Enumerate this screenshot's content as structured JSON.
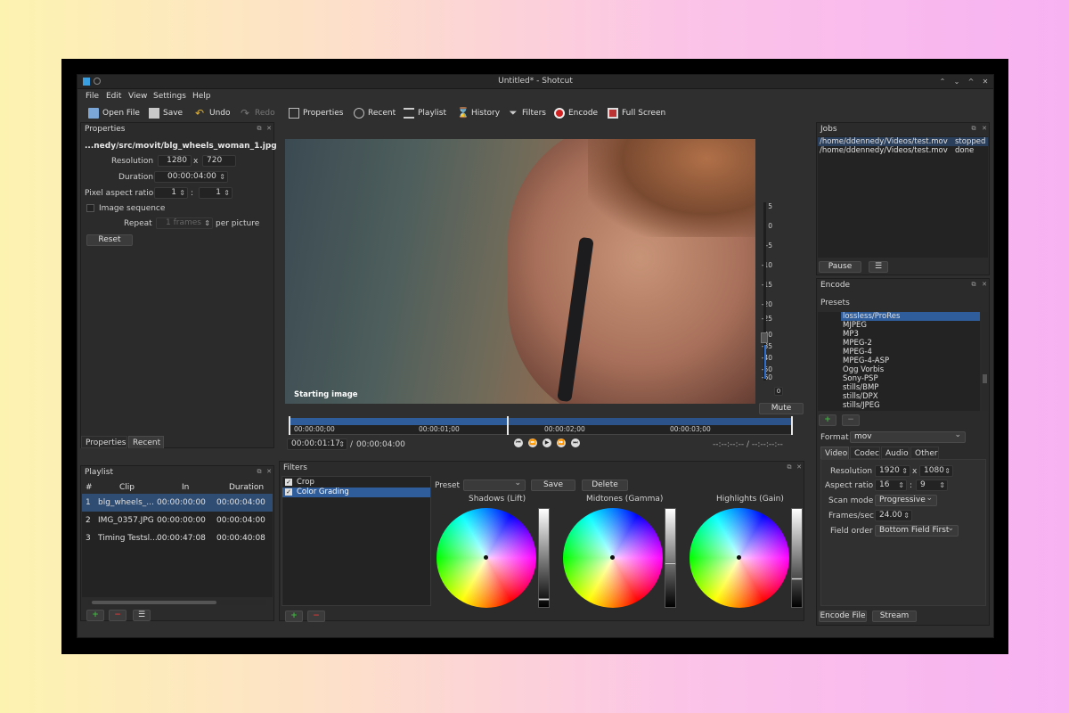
{
  "window": {
    "title": "Untitled* - Shotcut"
  },
  "menu": [
    "File",
    "Edit",
    "View",
    "Settings",
    "Help"
  ],
  "toolbar": {
    "open": "Open File",
    "save": "Save",
    "undo": "Undo",
    "redo": "Redo",
    "properties": "Properties",
    "recent": "Recent",
    "playlist": "Playlist",
    "history": "History",
    "filters": "Filters",
    "encode": "Encode",
    "fullscreen": "Full Screen"
  },
  "properties": {
    "title": "Properties",
    "filename": "...nedy/src/movit/blg_wheels_woman_1.jpg",
    "resolution_label": "Resolution",
    "res_w": "1280",
    "res_x": "x",
    "res_h": "720",
    "duration_label": "Duration",
    "duration": "00:00:04:00",
    "par_label": "Pixel aspect ratio",
    "par_a": "1",
    "par_colon": ":",
    "par_b": "1",
    "image_seq_label": "Image sequence",
    "repeat_label": "Repeat",
    "repeat_value": "1 frames",
    "per_picture": "per picture",
    "reset": "Reset",
    "tab_properties": "Properties",
    "tab_recent": "Recent"
  },
  "viewer": {
    "caption": "Starting image",
    "scale": [
      "5",
      "0",
      "-5",
      "-10",
      "-15",
      "-20",
      "-25",
      "-30",
      "-35",
      "-40",
      "-50",
      "-60"
    ],
    "mute": "Mute",
    "ruler": [
      "00:00:00;00",
      "00:00:01;00",
      "00:00:02;00",
      "00:00:03;00"
    ],
    "position": "00:00:01:17",
    "slash": "/",
    "total": "00:00:04:00",
    "inout": "--:--:--:-- / --:--:--:--"
  },
  "playlist": {
    "title": "Playlist",
    "columns": [
      "#",
      "Clip",
      "In",
      "Duration"
    ],
    "rows": [
      {
        "n": "1",
        "clip": "blg_wheels_...",
        "in": "00:00:00:00",
        "dur": "00:00:04:00"
      },
      {
        "n": "2",
        "clip": "IMG_0357.JPG",
        "in": "00:00:00:00",
        "dur": "00:00:04:00"
      },
      {
        "n": "3",
        "clip": "Timing Testsl...",
        "in": "00:00:47:08",
        "dur": "00:00:40:08"
      }
    ]
  },
  "filters": {
    "title": "Filters",
    "items": [
      "Crop",
      "Color Grading"
    ],
    "preset_label": "Preset",
    "save": "Save",
    "delete": "Delete",
    "wheels": [
      "Shadows (Lift)",
      "Midtones (Gamma)",
      "Highlights (Gain)"
    ],
    "levels": [
      0.05,
      0.43,
      0.27
    ]
  },
  "jobs": {
    "title": "Jobs",
    "items": [
      {
        "path": "/home/ddennedy/Videos/test.mov",
        "status": "stopped"
      },
      {
        "path": "/home/ddennedy/Videos/test.mov",
        "status": "done"
      }
    ],
    "pause": "Pause"
  },
  "encode": {
    "title": "Encode",
    "presets_label": "Presets",
    "presets": [
      "lossless/ProRes",
      "MJPEG",
      "MP3",
      "MPEG-2",
      "MPEG-4",
      "MPEG-4-ASP",
      "Ogg Vorbis",
      "Sony-PSP",
      "stills/BMP",
      "stills/DPX",
      "stills/JPEG"
    ],
    "format_label": "Format",
    "format": "mov",
    "tabs": [
      "Video",
      "Codec",
      "Audio",
      "Other"
    ],
    "resolution_label": "Resolution",
    "res_w": "1920",
    "res_x": "x",
    "res_h": "1080",
    "aspect_label": "Aspect ratio",
    "asp_a": "16",
    "asp_colon": ":",
    "asp_b": "9",
    "scan_label": "Scan mode",
    "scan": "Progressive",
    "fps_label": "Frames/sec",
    "fps": "24.00",
    "field_label": "Field order",
    "field": "Bottom Field First",
    "encode_file": "Encode File",
    "stream": "Stream"
  },
  "colors": {
    "accent": "#2f5d9c",
    "selection": "#2f4c72",
    "add": "#3fb33f",
    "remove": "#d03a3a"
  }
}
